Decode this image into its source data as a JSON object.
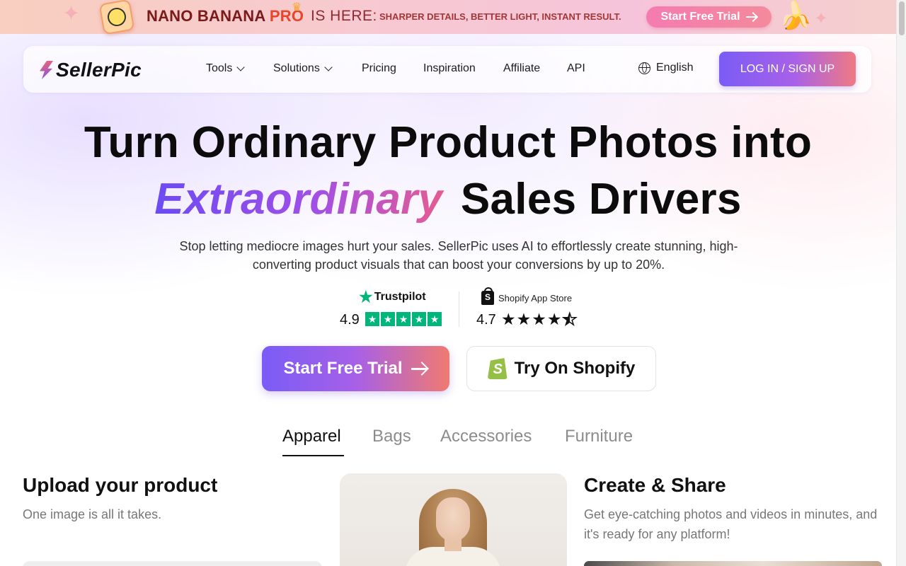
{
  "promo": {
    "title_main": "NANO BANANA ",
    "title_pro": "PRO",
    "title_here": "IS HERE:",
    "subtitle": "SHARPER DETAILS, BETTER LIGHT, INSTANT RESULT.",
    "cta_label": "Start Free Trial"
  },
  "nav": {
    "logo_text": "SellerPic",
    "items": [
      {
        "label": "Tools",
        "has_dropdown": true
      },
      {
        "label": "Solutions",
        "has_dropdown": true
      },
      {
        "label": "Pricing",
        "has_dropdown": false
      },
      {
        "label": "Inspiration",
        "has_dropdown": false
      },
      {
        "label": "Affiliate",
        "has_dropdown": false
      },
      {
        "label": "API",
        "has_dropdown": false
      }
    ],
    "language": "English",
    "login_label": "LOG IN / SIGN UP"
  },
  "hero": {
    "title_line1": "Turn Ordinary Product Photos into",
    "title_accent": "Extraordinary",
    "title_line2_rest": "Sales Drivers",
    "description": "Stop letting mediocre images hurt your sales. SellerPic uses AI to effortlessly create stunning, high-converting product visuals that can boost your conversions by up to 20%."
  },
  "ratings": {
    "trustpilot": {
      "name": "Trustpilot",
      "score": "4.9",
      "stars": 5
    },
    "shopify": {
      "name": "Shopify App Store",
      "score": "4.7",
      "stars": 4.5
    }
  },
  "cta": {
    "primary_label": "Start Free Trial",
    "secondary_label": "Try On Shopify"
  },
  "tabs": {
    "items": [
      "Apparel",
      "Bags",
      "Accessories",
      "Furniture"
    ],
    "active": "Apparel"
  },
  "steps": {
    "upload": {
      "title": "Upload your product",
      "description": "One image is all it takes."
    },
    "create": {
      "title": "Create & Share",
      "description": "Get eye-catching photos and videos in minutes, and it's ready for any platform!"
    }
  },
  "colors": {
    "accent_purple": "#7a5cf6",
    "accent_coral": "#f07a70",
    "trustpilot_green": "#00b67a",
    "shopify_green": "#95bf47"
  }
}
